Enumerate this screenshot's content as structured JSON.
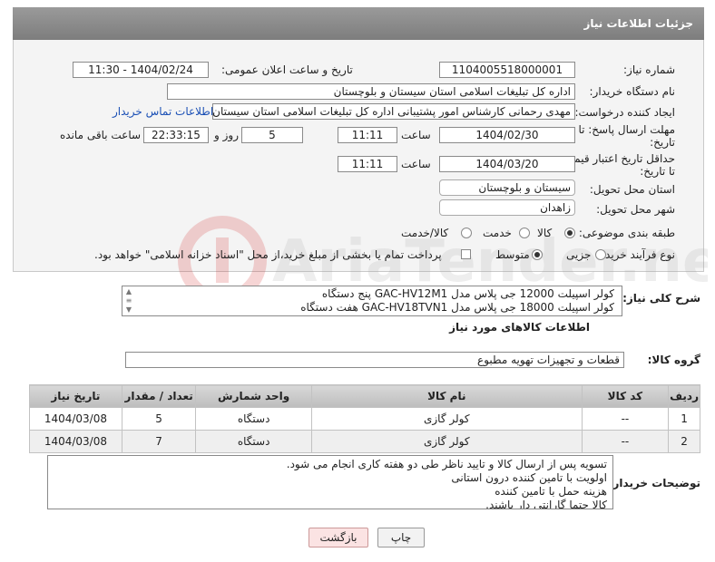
{
  "header": {
    "title": "جزئیات اطلاعات نیاز"
  },
  "labels": {
    "need_number": "شماره نیاز:",
    "announce_datetime": "تاریخ و ساعت اعلان عمومی:",
    "buyer_org": "نام دستگاه خریدار:",
    "requester": "ایجاد کننده درخواست:",
    "reply_deadline": "مهلت ارسال پاسخ: تا تاریخ:",
    "price_validity": "حداقل تاریخ اعتبار قیمت: تا تاریخ:",
    "time": "ساعت",
    "days_and": "روز و",
    "hours_left": "ساعت باقی مانده",
    "delivery_province": "استان محل تحویل:",
    "delivery_city": "شهر محل تحویل:",
    "category": "طبقه بندی موضوعی:",
    "purchase_type": "نوع فرآیند خرید :",
    "general_description": "شرح کلی نیاز:",
    "goods_info": "اطلاعات کالاهای مورد نیاز",
    "goods_group": "گروه کالا:",
    "buyer_notes": "توضیحات خریدار:"
  },
  "fields": {
    "need_number": "1104005518000001",
    "announce_datetime": "1404/02/24 - 11:30",
    "buyer_org": "اداره کل تبلیغات اسلامی استان سیستان و بلوچستان",
    "requester": "مهدی رحمانی کارشناس امور پشتیبانی اداره کل تبلیغات اسلامی استان سیستان",
    "contact_link": "اطلاعات تماس خریدار",
    "reply_date": "1404/02/30",
    "reply_time": "11:11",
    "days": "5",
    "remaining_time": "22:33:15",
    "validity_date": "1404/03/20",
    "validity_time": "11:11",
    "delivery_province": "سیستان و بلوچستان",
    "delivery_city": "زاهدان",
    "goods_group": "قطعات و تجهیزات تهویه مطبوع"
  },
  "category_options": [
    {
      "label": "کالا",
      "selected": true
    },
    {
      "label": "خدمت",
      "selected": false
    },
    {
      "label": "کالا/خدمت",
      "selected": false
    }
  ],
  "purchase_options": [
    {
      "label": "جزیی",
      "selected": false
    },
    {
      "label": "متوسط",
      "selected": true
    }
  ],
  "payment_note": "پرداخت تمام یا بخشی از مبلغ خرید،از محل \"اسناد خزانه اسلامی\" خواهد بود.",
  "description_lines": [
    "کولر اسپیلت 12000 جی پلاس مدل GAC-HV12M1  پنج دستگاه",
    "کولر اسپیلت 18000  جی پلاس مدل GAC-HV18TVN1    هفت دستگاه"
  ],
  "table": {
    "headers": [
      "ردیف",
      "کد کالا",
      "نام کالا",
      "واحد شمارش",
      "تعداد / مقدار",
      "تاریخ نیاز"
    ],
    "rows": [
      [
        "1",
        "--",
        "کولر گازی",
        "دستگاه",
        "5",
        "1404/03/08"
      ],
      [
        "2",
        "--",
        "کولر گازی",
        "دستگاه",
        "7",
        "1404/03/08"
      ]
    ]
  },
  "notes_lines": [
    "تسویه پس از ارسال کالا و تایید ناظر طی دو هفته کاری انجام می شود.",
    "اولویت با تامین کننده درون استانی",
    "هزینه حمل با تامین کننده",
    "کالا حتما گارانتی دار باشند."
  ],
  "buttons": {
    "print": "چاپ",
    "back": "بازگشت"
  },
  "watermark": "AriaTender.net",
  "colors": {
    "header": "#8a8a8a",
    "link": "#1a4fb5",
    "back_button": "#fbe3e3",
    "print_button": "#f2f2f2"
  }
}
